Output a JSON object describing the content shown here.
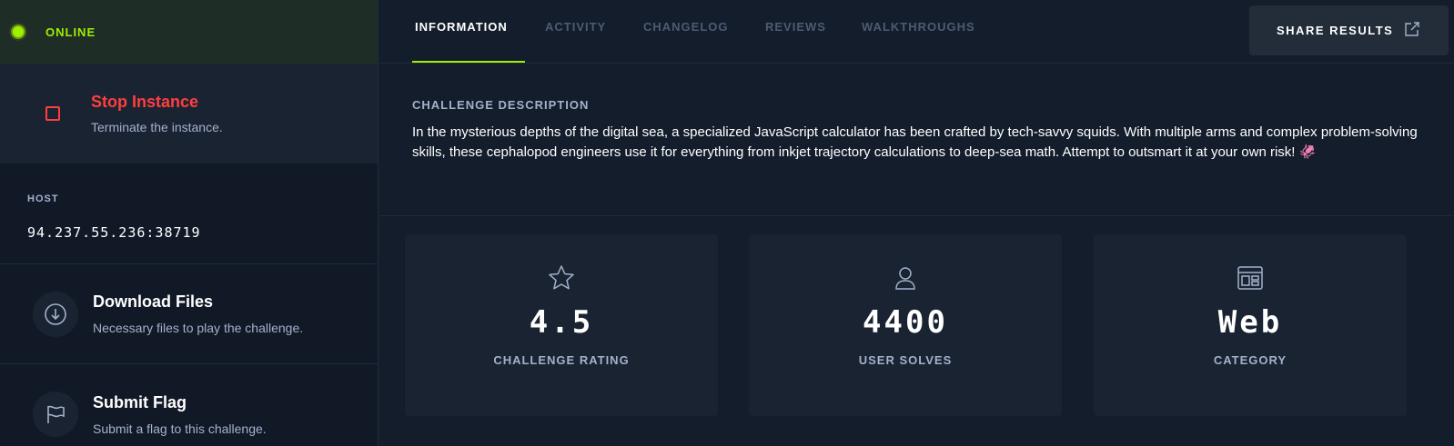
{
  "status": {
    "text": "ONLINE",
    "color": "#9fef00"
  },
  "stop": {
    "title": "Stop Instance",
    "subtitle": "Terminate the instance.",
    "color": "#ff3e3e"
  },
  "host": {
    "label": "HOST",
    "value": "94.237.55.236:38719"
  },
  "actions": [
    {
      "title": "Download Files",
      "subtitle": "Necessary files to play the challenge.",
      "icon": "download-icon"
    },
    {
      "title": "Submit Flag",
      "subtitle": "Submit a flag to this challenge.",
      "icon": "flag-icon"
    }
  ],
  "tabs": [
    {
      "label": "INFORMATION",
      "active": true
    },
    {
      "label": "ACTIVITY",
      "active": false
    },
    {
      "label": "CHANGELOG",
      "active": false
    },
    {
      "label": "REVIEWS",
      "active": false
    },
    {
      "label": "WALKTHROUGHS",
      "active": false
    }
  ],
  "share": {
    "label": "SHARE RESULTS",
    "icon": "external-share-icon"
  },
  "description": {
    "label": "CHALLENGE DESCRIPTION",
    "text": "In the mysterious depths of the digital sea, a specialized JavaScript calculator has been crafted by tech-savvy squids. With multiple arms and complex problem-solving skills, these cephalopod engineers use it for everything from inkjet trajectory calculations to deep-sea math. Attempt to outsmart it at your own risk! 🦑"
  },
  "stats": [
    {
      "value": "4.5",
      "label": "CHALLENGE RATING",
      "icon": "star-icon"
    },
    {
      "value": "4400",
      "label": "USER SOLVES",
      "icon": "user-icon"
    },
    {
      "value": "Web",
      "label": "CATEGORY",
      "icon": "browser-window-icon"
    }
  ],
  "accent": "#9fef00"
}
